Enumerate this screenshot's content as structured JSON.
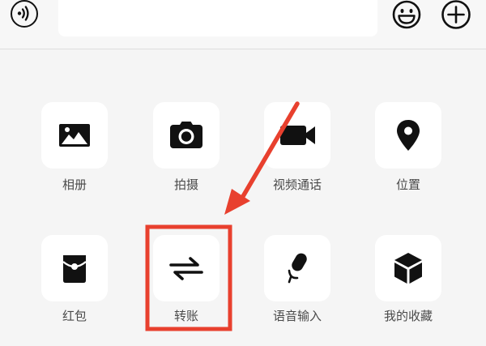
{
  "input_bar": {
    "voice_icon": "voice-wave-icon",
    "text_value": "",
    "emoji_icon": "smiley-face-icon",
    "plus_icon": "plus-circle-icon"
  },
  "panel": {
    "items": [
      {
        "label": "相册",
        "icon": "photo-album-icon"
      },
      {
        "label": "拍摄",
        "icon": "camera-icon"
      },
      {
        "label": "视频通话",
        "icon": "video-call-icon"
      },
      {
        "label": "位置",
        "icon": "location-pin-icon"
      },
      {
        "label": "红包",
        "icon": "red-envelope-icon"
      },
      {
        "label": "转账",
        "icon": "transfer-arrows-icon"
      },
      {
        "label": "语音输入",
        "icon": "microphone-icon"
      },
      {
        "label": "我的收藏",
        "icon": "favorites-cube-icon"
      }
    ]
  },
  "annotation": {
    "color": "#e8402e",
    "highlighted_item": "转账"
  },
  "colors": {
    "background": "#f5f5f5",
    "tile": "#ffffff",
    "icon": "#111111",
    "label": "#4a4a4a"
  }
}
